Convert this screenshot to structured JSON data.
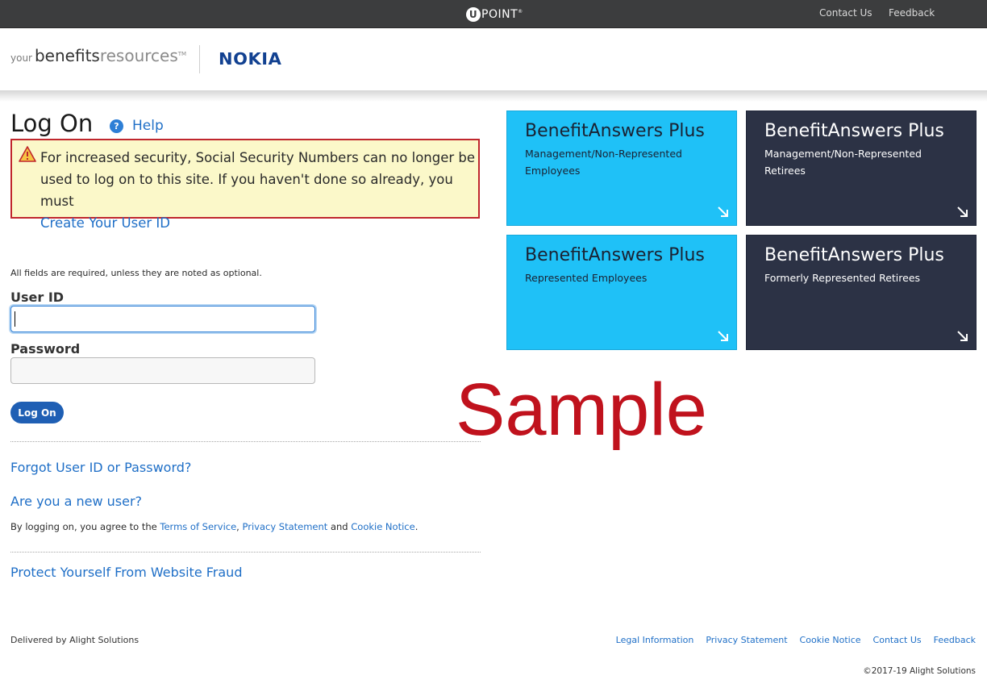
{
  "topbar": {
    "logo_letter": "U",
    "logo_text": "POINT",
    "logo_tm": "®",
    "contact_us": "Contact Us",
    "feedback": "Feedback"
  },
  "header": {
    "logo_your": "your",
    "logo_benefits": "benefits",
    "logo_resources": "resources",
    "logo_tm": "TM",
    "partner_logo": "NOKIA"
  },
  "login": {
    "title": "Log On",
    "help_label": "Help",
    "help_glyph": "?",
    "alert_text": "For increased security, Social Security Numbers can no longer be used to log on to this site. If you haven't done so already, you must",
    "alert_link": "Create Your User ID",
    "required_note": "All fields are required, unless they are noted as optional.",
    "userid_label": "User ID",
    "userid_value": "",
    "password_label": "Password",
    "password_value": "",
    "logon_button": "Log On",
    "forgot_link": "Forgot User ID or Password?",
    "new_user_link": "Are you a new user?",
    "agree_prefix": "By logging on, you agree to the",
    "terms_link": "Terms of Service",
    "comma": ",",
    "privacy_link": "Privacy Statement",
    "and_text": "and",
    "cookie_link": "Cookie Notice",
    "period": ".",
    "fraud_link": "Protect Yourself From Website Fraud"
  },
  "tiles": [
    {
      "title": "BenefitAnswers Plus",
      "subtitle": "Management/Non-Represented Employees"
    },
    {
      "title": "BenefitAnswers Plus",
      "subtitle": "Management/Non-Represented Retirees"
    },
    {
      "title": "BenefitAnswers Plus",
      "subtitle": "Represented Employees"
    },
    {
      "title": "BenefitAnswers Plus",
      "subtitle": "Formerly Represented Retirees"
    }
  ],
  "watermark": "Sample",
  "footer": {
    "delivered_by": "Delivered by Alight Solutions",
    "links": [
      "Legal Information",
      "Privacy Statement",
      "Cookie Notice",
      "Contact Us",
      "Feedback"
    ],
    "copyright": "©2017-19 Alight Solutions"
  },
  "colors": {
    "tile_light": "#1fc1f7",
    "tile_dark": "#2c3245",
    "link": "#1f6fc7",
    "alert_border": "#c0272d",
    "alert_bg": "#fbf8c9",
    "topbar": "#3c3d3e"
  }
}
